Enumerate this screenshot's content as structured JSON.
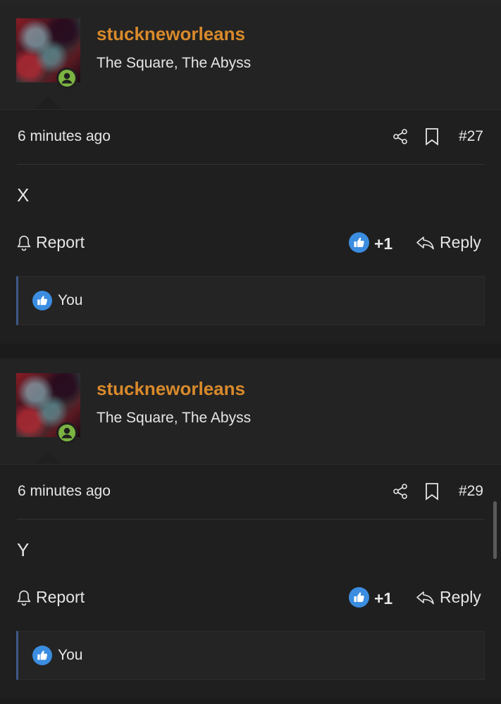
{
  "posts": [
    {
      "username": "stuckneworleans",
      "location": "The Square, The Abyss",
      "time": "6 minutes ago",
      "number": "#27",
      "content": "X",
      "report_label": "Report",
      "like_count": "+1",
      "reply_label": "Reply",
      "reacted_by": "You"
    },
    {
      "username": "stuckneworleans",
      "location": "The Square, The Abyss",
      "time": "6 minutes ago",
      "number": "#29",
      "content": "Y",
      "report_label": "Report",
      "like_count": "+1",
      "reply_label": "Reply",
      "reacted_by": "You"
    }
  ],
  "colors": {
    "background": "#1b1b1b",
    "username": "#d98a2b",
    "online_badge": "#7cb342",
    "like_blue": "#3b8de0",
    "reaction_border": "#3f5a8a"
  },
  "icons": [
    "online-badge-icon",
    "share-icon",
    "bookmark-icon",
    "bell-icon",
    "like-icon",
    "reply-icon"
  ]
}
